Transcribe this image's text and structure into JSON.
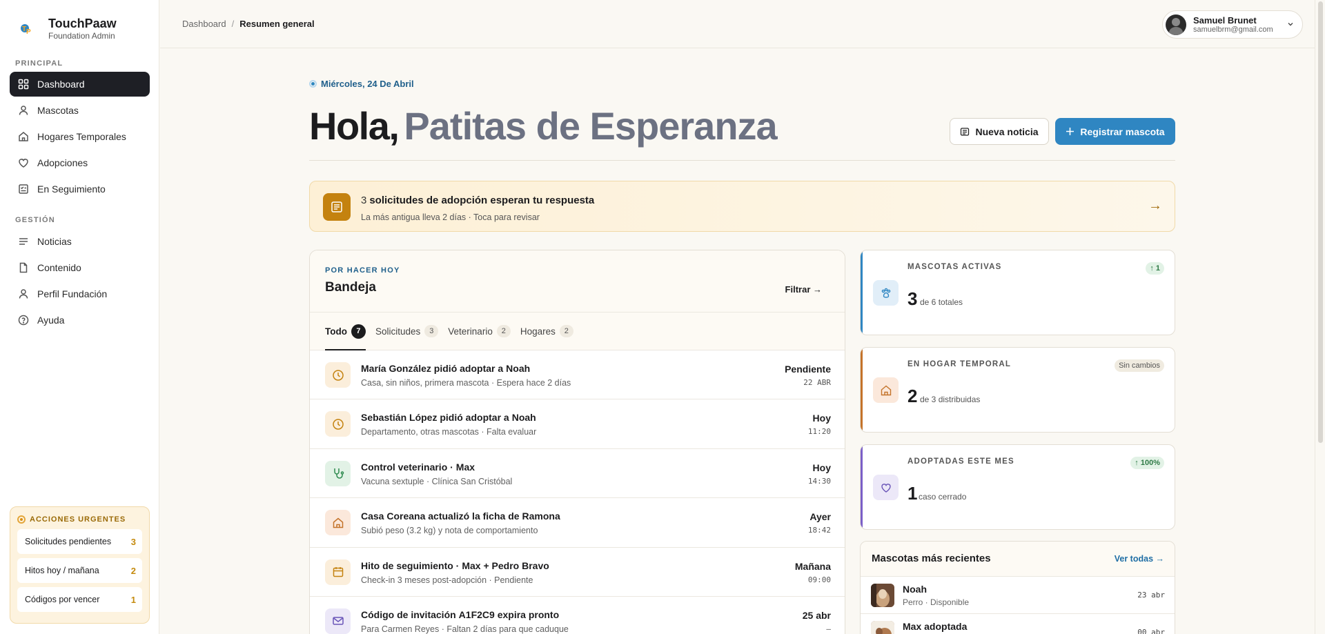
{
  "brand": {
    "name": "TouchPaaw",
    "subtitle": "Foundation Admin"
  },
  "sidebar": {
    "principal_label": "PRINCIPAL",
    "principal": [
      {
        "label": "Dashboard",
        "icon": "grid-icon",
        "active": true
      },
      {
        "label": "Mascotas",
        "icon": "user-icon"
      },
      {
        "label": "Hogares Temporales",
        "icon": "home-icon"
      },
      {
        "label": "Adopciones",
        "icon": "heart-icon"
      },
      {
        "label": "En Seguimiento",
        "icon": "checklist-icon"
      }
    ],
    "gestion_label": "GESTIÓN",
    "gestion": [
      {
        "label": "Noticias",
        "icon": "lines-icon"
      },
      {
        "label": "Contenido",
        "icon": "file-icon"
      },
      {
        "label": "Perfil Fundación",
        "icon": "user-icon"
      },
      {
        "label": "Ayuda",
        "icon": "help-icon"
      }
    ],
    "urgent": {
      "title": "ACCIONES URGENTES",
      "items": [
        {
          "label": "Solicitudes pendientes",
          "count": "3"
        },
        {
          "label": "Hitos hoy / mañana",
          "count": "2"
        },
        {
          "label": "Códigos por vencer",
          "count": "1"
        }
      ]
    }
  },
  "topbar": {
    "breadcrumb": [
      "Dashboard",
      "/",
      "Resumen general"
    ],
    "user": {
      "name": "Samuel Brunet",
      "email": "samuelbrm@gmail.com"
    }
  },
  "hero": {
    "date": "Miércoles, 24 De Abril",
    "hello": "Hola,",
    "org": "Patitas de Esperanza",
    "btn_news": "Nueva noticia",
    "btn_register": "Registrar mascota"
  },
  "banner": {
    "count": "3",
    "title": "solicitudes de adopción esperan tu respuesta",
    "subtitle": "La más antigua lleva 2 días · Toca para revisar",
    "arrow": "→"
  },
  "inbox": {
    "eyebrow": "POR HACER HOY",
    "title": "Bandeja",
    "filter": "Filtrar →",
    "tabs": [
      {
        "label": "Todo",
        "count": "7"
      },
      {
        "label": "Solicitudes",
        "count": "3"
      },
      {
        "label": "Veterinario",
        "count": "2"
      },
      {
        "label": "Hogares",
        "count": "2"
      }
    ],
    "rows": [
      {
        "title": "María González pidió adoptar a",
        "pet": "Noah",
        "sub": "Casa, sin niños, primera mascota · Espera hace 2 días",
        "status": "Pendiente",
        "time": "22 ABR",
        "icon": "clock-icon"
      },
      {
        "title": "Sebastián López pidió adoptar a",
        "pet": "Noah",
        "sub": "Departamento, otras mascotas · Falta evaluar",
        "status": "Hoy",
        "time": "11:20",
        "icon": "clock-icon"
      },
      {
        "title": "Control veterinario ·",
        "pet": "Max",
        "sub": "Vacuna sextuple · Clínica San Cristóbal",
        "status": "Hoy",
        "time": "14:30",
        "icon": "stethoscope-icon"
      },
      {
        "title": "Casa Coreana actualizó la ficha de",
        "pet": "Ramona",
        "sub": "Subió peso (3.2 kg) y nota de comportamiento",
        "status": "Ayer",
        "time": "18:42",
        "icon": "home-icon"
      },
      {
        "title": "Hito de seguimiento ·",
        "pet": "Max + Pedro Bravo",
        "sub": "Check-in 3 meses post-adopción · Pendiente",
        "status": "Mañana",
        "time": "09:00",
        "icon": "calendar-icon"
      },
      {
        "title": "Código de invitación",
        "pet": "A1F2C9  expira pronto",
        "sub": "Para Carmen Reyes · Faltan 2 días para que caduque",
        "status": "25 abr",
        "time": "—",
        "icon": "mail-icon"
      }
    ]
  },
  "stats": [
    {
      "label": "MASCOTAS ACTIVAS",
      "value": "3",
      "desc": "de 6 totales",
      "chip": "↑ 1",
      "icon": "paw-icon",
      "accent": "#2f86c2"
    },
    {
      "label": "EN HOGAR TEMPORAL",
      "value": "2",
      "desc": "de 3 distribuidas",
      "chip": "Sin cambios",
      "icon": "home-icon",
      "accent": "#c4732a"
    },
    {
      "label": "ADOPTADAS ESTE MES",
      "value": "1",
      "desc": "caso cerrado",
      "chip": "↑ 100%",
      "icon": "heart-icon",
      "accent": "#7b5fc7"
    }
  ],
  "recent": {
    "title": "Mascotas más recientes",
    "see_all": "Ver todas →",
    "items": [
      {
        "name": "Noah",
        "meta": "Perro · Disponible",
        "date": "23 abr"
      },
      {
        "name": "Max adoptada",
        "meta": "",
        "date": "00 abr"
      }
    ]
  },
  "colors": {
    "primary": "#2f86c2",
    "dark": "#1e1f25",
    "warning": "#c4820f"
  }
}
